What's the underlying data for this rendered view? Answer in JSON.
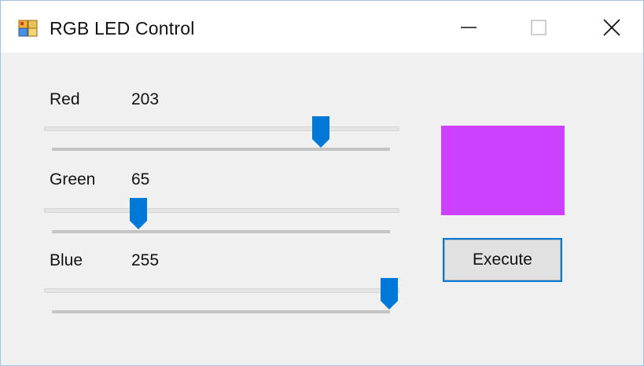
{
  "window": {
    "title": "RGB LED Control",
    "controls": [
      "minimize",
      "maximize",
      "close"
    ]
  },
  "sliders": [
    {
      "label": "Red",
      "value": "203",
      "min": 0,
      "max": 255,
      "level": 203
    },
    {
      "label": "Green",
      "value": "65",
      "min": 0,
      "max": 255,
      "level": 65
    },
    {
      "label": "Blue",
      "value": "255",
      "min": 0,
      "max": 255,
      "level": 255
    }
  ],
  "preview": {
    "color": "#cb41ff"
  },
  "execute_button": {
    "label": "Execute"
  },
  "colors": {
    "accent": "#0078d7",
    "title_bg": "#ffffff",
    "window_bg": "#f0f0f0"
  }
}
